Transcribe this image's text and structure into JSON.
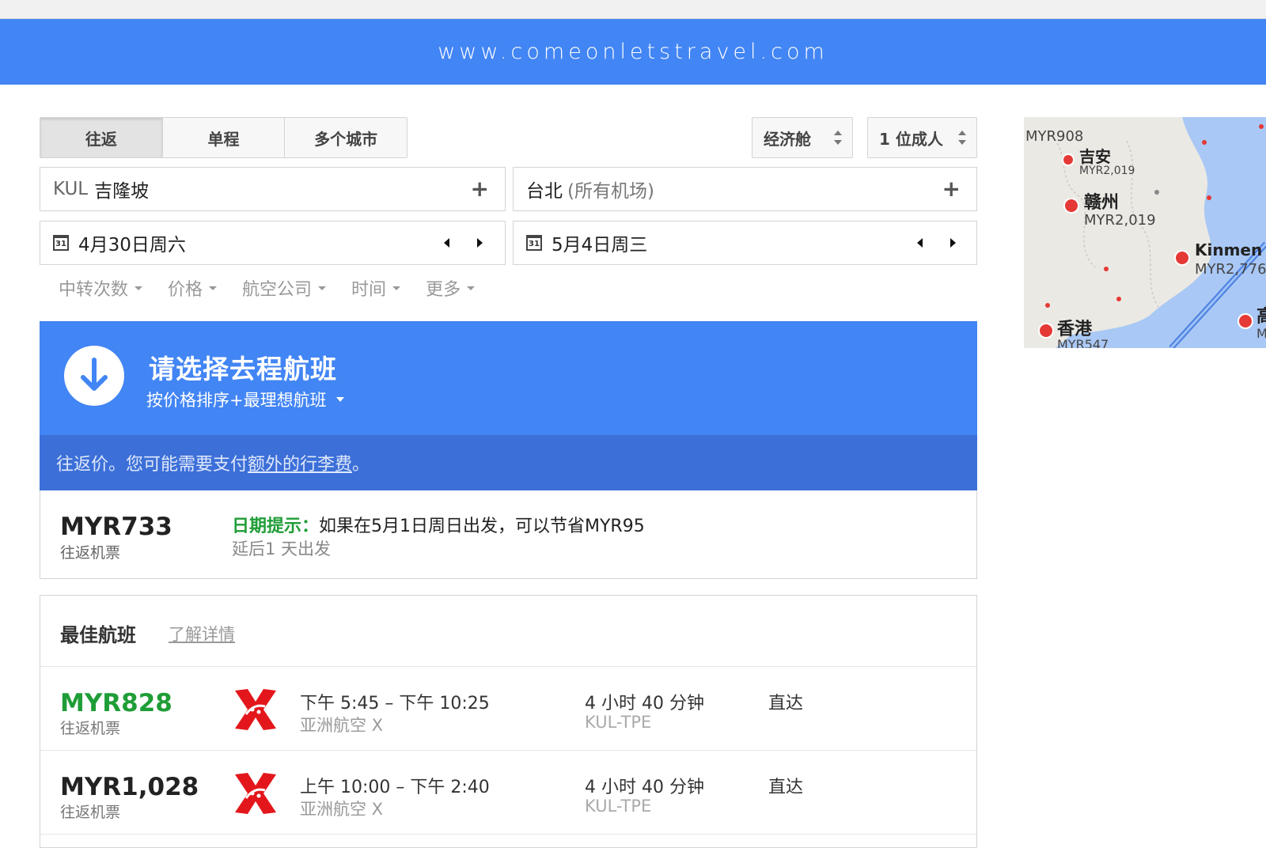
{
  "banner": {
    "text": "www.comeonletstravel.com"
  },
  "trip_type": {
    "tabs": [
      {
        "label": "往返"
      },
      {
        "label": "单程"
      },
      {
        "label": "多个城市"
      }
    ]
  },
  "cabin": {
    "value": "经济舱"
  },
  "passengers": {
    "value": "1 位成人"
  },
  "origin": {
    "code": "KUL",
    "city": "吉隆坡"
  },
  "destination": {
    "city": "台北",
    "detail": "(所有机场)"
  },
  "depart_date": {
    "value": "4月30日周六",
    "cal": "31"
  },
  "return_date": {
    "value": "5月4日周三",
    "cal": "31"
  },
  "filters": [
    {
      "label": "中转次数"
    },
    {
      "label": "价格"
    },
    {
      "label": "航空公司"
    },
    {
      "label": "时间"
    },
    {
      "label": "更多"
    }
  ],
  "select_panel": {
    "title": "请选择去程航班",
    "sort_label": "按价格排序+最理想航班"
  },
  "notice": {
    "prefix": "往返价。您可能需要支付",
    "link": "额外的行李费",
    "suffix": "。"
  },
  "date_tip": {
    "price": "MYR733",
    "price_sub": "往返机票",
    "label": "日期提示：",
    "message": "如果在5月1日周日出发，可以节省MYR95",
    "sub": "延后1 天出发"
  },
  "best_flights": {
    "title": "最佳航班",
    "link": "了解详情",
    "rows": [
      {
        "price": "MYR828",
        "price_sub": "往返机票",
        "time": "下午 5:45 – 下午 10:25",
        "airline": "亚洲航空 X",
        "duration": "4 小时 40 分钟",
        "route": "KUL-TPE",
        "stops": "直达"
      },
      {
        "price": "MYR1,028",
        "price_sub": "往返机票",
        "time": "上午 10:00 – 下午 2:40",
        "airline": "亚洲航空 X",
        "duration": "4 小时 40 分钟",
        "route": "KUL-TPE",
        "stops": "直达"
      }
    ]
  },
  "map": {
    "pins": [
      {
        "label": "",
        "price": "MYR908"
      },
      {
        "label": "吉安",
        "price": "MYR2,019"
      },
      {
        "label": "赣州",
        "price": "MYR2,019"
      },
      {
        "label": "Kinmen",
        "price": "MYR2,776"
      },
      {
        "label": "香港",
        "price": "MYR547"
      },
      {
        "label": "高",
        "price": "M"
      }
    ]
  },
  "colors": {
    "brand_blue": "#4285f4",
    "notice_blue": "#3c6fd8",
    "green": "#1f9d37",
    "pin_red": "#e53935"
  }
}
